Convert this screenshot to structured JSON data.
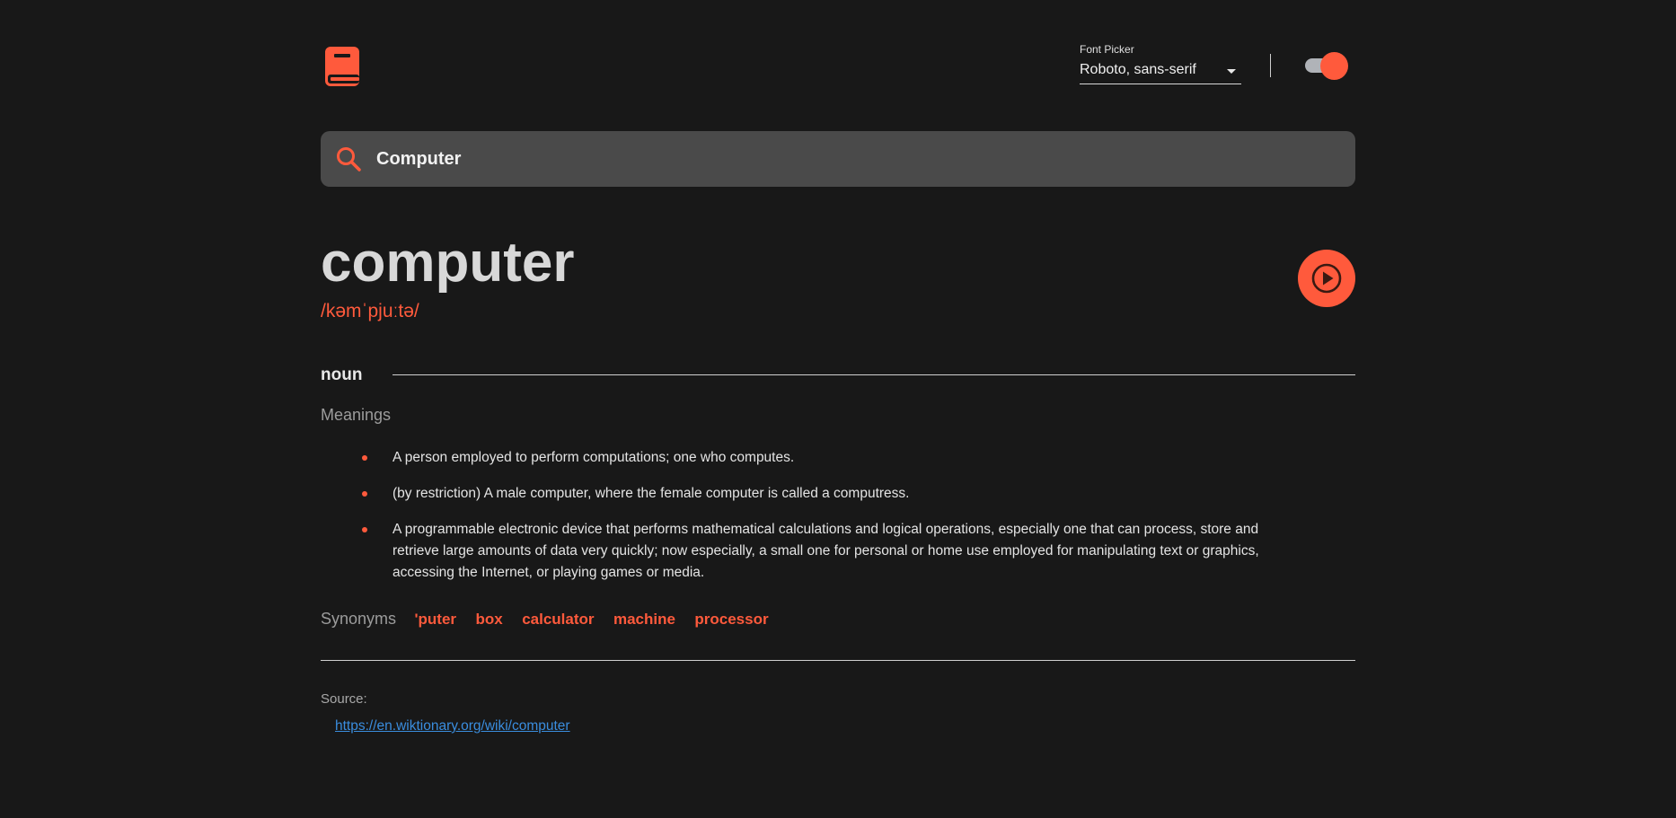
{
  "header": {
    "logo_icon": "book-icon",
    "font_picker": {
      "label": "Font Picker",
      "selected": "Roboto, sans-serif"
    },
    "theme_toggle": {
      "icon": "toggle-switch",
      "state": "on"
    }
  },
  "search": {
    "icon": "search-icon",
    "value": "Computer"
  },
  "word": {
    "text": "computer",
    "phonetic": "/kəmˈpjuːtə/",
    "play_icon": "play-icon"
  },
  "meaning": {
    "part_of_speech": "noun",
    "heading": "Meanings",
    "definitions": [
      "A person employed to perform computations; one who computes.",
      "(by restriction) A male computer, where the female computer is called a computress.",
      "A programmable electronic device that performs mathematical calculations and logical operations, especially one that can process, store and retrieve large amounts of data very quickly; now especially, a small one for personal or home use employed for manipulating text or graphics, accessing the Internet, or playing games or media."
    ],
    "synonyms_label": "Synonyms",
    "synonyms": [
      "'puter",
      "box",
      "calculator",
      "machine",
      "processor"
    ]
  },
  "source": {
    "label": "Source:",
    "url": "https://en.wiktionary.org/wiki/computer"
  },
  "colors": {
    "background": "#181818",
    "accent": "#ff5a3c",
    "search_bg": "#4a4a4a",
    "link": "#3a8dde"
  }
}
